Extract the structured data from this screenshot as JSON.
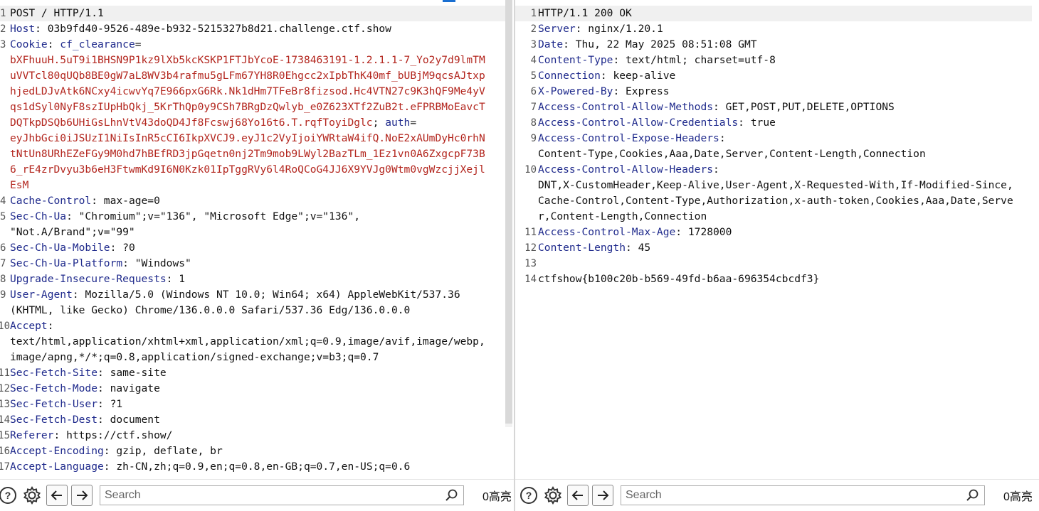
{
  "request": {
    "lines": [
      {
        "n": "1",
        "parts": [
          {
            "t": "POST / HTTP/1.1",
            "c": "v"
          }
        ],
        "hl": true
      },
      {
        "n": "2",
        "parts": [
          {
            "t": "Host",
            "c": "k"
          },
          {
            "t": ": 03b9fd40-9526-489e-b932-5215327b8d21.challenge.ctf.show",
            "c": "v"
          }
        ]
      },
      {
        "n": "3",
        "parts": [
          {
            "t": "Cookie",
            "c": "k"
          },
          {
            "t": ": ",
            "c": "v"
          },
          {
            "t": "cf_clearance",
            "c": "k"
          },
          {
            "t": "=",
            "c": "v"
          }
        ]
      },
      {
        "n": "",
        "parts": [
          {
            "t": "bXFhuuH.5uT9i1BHSN9P1kz9lXb5kcKSKP1FTJbYcoE-1738463191-1.2.1.1-7_Yo2y7d9lmTM",
            "c": "r"
          }
        ]
      },
      {
        "n": "",
        "parts": [
          {
            "t": "uVVTcl80qUQb8BE0gW7aL8WV3b4rafmu5gLFm67YH8R0Ehgcc2xIpbThK40mf_bUBjM9qcsAJtxp",
            "c": "r"
          }
        ]
      },
      {
        "n": "",
        "parts": [
          {
            "t": "hjedLDJvAtk6NCxy4icwvYq7E966pxG6Rk.Nk1dHm7TFeBr8fizsod.Hc4VTN27c9K3hQF9Me4yV",
            "c": "r"
          }
        ]
      },
      {
        "n": "",
        "parts": [
          {
            "t": "qs1dSyl0NyF8szIUpHbQkj_5KrThQp0y9CSh7BRgDzQwlyb_e0Z623XTf2ZuB2t.eFPRBMoEavcT",
            "c": "r"
          }
        ]
      },
      {
        "n": "",
        "parts": [
          {
            "t": "DQTkpDSQb6UHiGsLhnVtV43doQD4Jf8Fcswj68Yo16t6.T.rqfToyiDglc",
            "c": "r"
          },
          {
            "t": "; ",
            "c": "v"
          },
          {
            "t": "auth",
            "c": "k"
          },
          {
            "t": "=",
            "c": "v"
          }
        ]
      },
      {
        "n": "",
        "parts": [
          {
            "t": "eyJhbGci0iJSUzI1NiIsInR5cCI6IkpXVCJ9.eyJ1c2VyIjoiYWRtaW4ifQ.NoE2xAUmDyHc0rhN",
            "c": "r"
          }
        ]
      },
      {
        "n": "",
        "parts": [
          {
            "t": "tNtUn8URhEZeFGy9M0hd7hBEfRD3jpGqetn0nj2Tm9mob9LWyl2BazTLm_1Ez1vn0A6ZxgcpF73B",
            "c": "r"
          }
        ]
      },
      {
        "n": "",
        "parts": [
          {
            "t": "6_rE4zrDvyu3b6eH3FtwmKd9I6N0Kzk01IpTggRVy6l4RoQCoG4JJ6X9YVJg0Wtm0vgWzcjjXejl",
            "c": "r"
          }
        ]
      },
      {
        "n": "",
        "parts": [
          {
            "t": "EsM",
            "c": "r"
          }
        ]
      },
      {
        "n": "4",
        "parts": [
          {
            "t": "Cache-Control",
            "c": "k"
          },
          {
            "t": ": max-age=0",
            "c": "v"
          }
        ]
      },
      {
        "n": "5",
        "parts": [
          {
            "t": "Sec-Ch-Ua",
            "c": "k"
          },
          {
            "t": ": \"Chromium\";v=\"136\", \"Microsoft Edge\";v=\"136\",",
            "c": "v"
          }
        ]
      },
      {
        "n": "",
        "parts": [
          {
            "t": "\"Not.A/Brand\";v=\"99\"",
            "c": "v"
          }
        ]
      },
      {
        "n": "6",
        "parts": [
          {
            "t": "Sec-Ch-Ua-Mobile",
            "c": "k"
          },
          {
            "t": ": ?0",
            "c": "v"
          }
        ]
      },
      {
        "n": "7",
        "parts": [
          {
            "t": "Sec-Ch-Ua-Platform",
            "c": "k"
          },
          {
            "t": ": \"Windows\"",
            "c": "v"
          }
        ]
      },
      {
        "n": "8",
        "parts": [
          {
            "t": "Upgrade-Insecure-Requests",
            "c": "k"
          },
          {
            "t": ": 1",
            "c": "v"
          }
        ]
      },
      {
        "n": "9",
        "parts": [
          {
            "t": "User-Agent",
            "c": "k"
          },
          {
            "t": ": Mozilla/5.0 (Windows NT 10.0; Win64; x64) AppleWebKit/537.36",
            "c": "v"
          }
        ]
      },
      {
        "n": "",
        "parts": [
          {
            "t": "(KHTML, like Gecko) Chrome/136.0.0.0 Safari/537.36 Edg/136.0.0.0",
            "c": "v"
          }
        ]
      },
      {
        "n": "10",
        "parts": [
          {
            "t": "Accept",
            "c": "k"
          },
          {
            "t": ":",
            "c": "v"
          }
        ]
      },
      {
        "n": "",
        "parts": [
          {
            "t": "text/html,application/xhtml+xml,application/xml;q=0.9,image/avif,image/webp,",
            "c": "v"
          }
        ]
      },
      {
        "n": "",
        "parts": [
          {
            "t": "image/apng,*/*;q=0.8,application/signed-exchange;v=b3;q=0.7",
            "c": "v"
          }
        ]
      },
      {
        "n": "11",
        "parts": [
          {
            "t": "Sec-Fetch-Site",
            "c": "k"
          },
          {
            "t": ": same-site",
            "c": "v"
          }
        ]
      },
      {
        "n": "12",
        "parts": [
          {
            "t": "Sec-Fetch-Mode",
            "c": "k"
          },
          {
            "t": ": navigate",
            "c": "v"
          }
        ]
      },
      {
        "n": "13",
        "parts": [
          {
            "t": "Sec-Fetch-User",
            "c": "k"
          },
          {
            "t": ": ?1",
            "c": "v"
          }
        ]
      },
      {
        "n": "14",
        "parts": [
          {
            "t": "Sec-Fetch-Dest",
            "c": "k"
          },
          {
            "t": ": document",
            "c": "v"
          }
        ]
      },
      {
        "n": "15",
        "parts": [
          {
            "t": "Referer",
            "c": "k"
          },
          {
            "t": ": https://ctf.show/",
            "c": "v"
          }
        ]
      },
      {
        "n": "16",
        "parts": [
          {
            "t": "Accept-Encoding",
            "c": "k"
          },
          {
            "t": ": gzip, deflate, br",
            "c": "v"
          }
        ]
      },
      {
        "n": "17",
        "parts": [
          {
            "t": "Accept-Language",
            "c": "k"
          },
          {
            "t": ": zh-CN,zh;q=0.9,en;q=0.8,en-GB;q=0.7,en-US;q=0.6",
            "c": "v"
          }
        ]
      }
    ],
    "search_placeholder": "Search",
    "highlight_count": "0高亮"
  },
  "response": {
    "lines": [
      {
        "n": "1",
        "parts": [
          {
            "t": "HTTP/1.1 200 OK",
            "c": "v"
          }
        ],
        "hl": true
      },
      {
        "n": "2",
        "parts": [
          {
            "t": "Server",
            "c": "k"
          },
          {
            "t": ": nginx/1.20.1",
            "c": "v"
          }
        ]
      },
      {
        "n": "3",
        "parts": [
          {
            "t": "Date",
            "c": "k"
          },
          {
            "t": ": Thu, 22 May 2025 08:51:08 GMT",
            "c": "v"
          }
        ]
      },
      {
        "n": "4",
        "parts": [
          {
            "t": "Content-Type",
            "c": "k"
          },
          {
            "t": ": text/html; charset=utf-8",
            "c": "v"
          }
        ]
      },
      {
        "n": "5",
        "parts": [
          {
            "t": "Connection",
            "c": "k"
          },
          {
            "t": ": keep-alive",
            "c": "v"
          }
        ]
      },
      {
        "n": "6",
        "parts": [
          {
            "t": "X-Powered-By",
            "c": "k"
          },
          {
            "t": ": Express",
            "c": "v"
          }
        ]
      },
      {
        "n": "7",
        "parts": [
          {
            "t": "Access-Control-Allow-Methods",
            "c": "k"
          },
          {
            "t": ": GET,POST,PUT,DELETE,OPTIONS",
            "c": "v"
          }
        ]
      },
      {
        "n": "8",
        "parts": [
          {
            "t": "Access-Control-Allow-Credentials",
            "c": "k"
          },
          {
            "t": ": true",
            "c": "v"
          }
        ]
      },
      {
        "n": "9",
        "parts": [
          {
            "t": "Access-Control-Expose-Headers",
            "c": "k"
          },
          {
            "t": ":",
            "c": "v"
          }
        ]
      },
      {
        "n": "",
        "parts": [
          {
            "t": "Content-Type,Cookies,Aaa,Date,Server,Content-Length,Connection",
            "c": "v"
          }
        ]
      },
      {
        "n": "10",
        "parts": [
          {
            "t": "Access-Control-Allow-Headers",
            "c": "k"
          },
          {
            "t": ":",
            "c": "v"
          }
        ]
      },
      {
        "n": "",
        "parts": [
          {
            "t": "DNT,X-CustomHeader,Keep-Alive,User-Agent,X-Requested-With,If-Modified-Since,",
            "c": "v"
          }
        ]
      },
      {
        "n": "",
        "parts": [
          {
            "t": "Cache-Control,Content-Type,Authorization,x-auth-token,Cookies,Aaa,Date,Serve",
            "c": "v"
          }
        ]
      },
      {
        "n": "",
        "parts": [
          {
            "t": "r,Content-Length,Connection",
            "c": "v"
          }
        ]
      },
      {
        "n": "11",
        "parts": [
          {
            "t": "Access-Control-Max-Age",
            "c": "k"
          },
          {
            "t": ": 1728000",
            "c": "v"
          }
        ]
      },
      {
        "n": "12",
        "parts": [
          {
            "t": "Content-Length",
            "c": "k"
          },
          {
            "t": ": 45",
            "c": "v"
          }
        ]
      },
      {
        "n": "13",
        "parts": [
          {
            "t": "",
            "c": "v"
          }
        ]
      },
      {
        "n": "14",
        "parts": [
          {
            "t": "ctfshow{b100c20b-b569-49fd-b6aa-696354cbcdf3}",
            "c": "v"
          }
        ]
      }
    ],
    "search_placeholder": "Search",
    "highlight_count": "0高亮"
  },
  "colors": {
    "header_name": "#1f2a8c",
    "cookie_value": "#b3261e",
    "text": "#111111",
    "accent": "#1a6fd1"
  },
  "icons": [
    "help-icon",
    "gear-icon",
    "arrow-left-icon",
    "arrow-right-icon",
    "search-icon"
  ]
}
